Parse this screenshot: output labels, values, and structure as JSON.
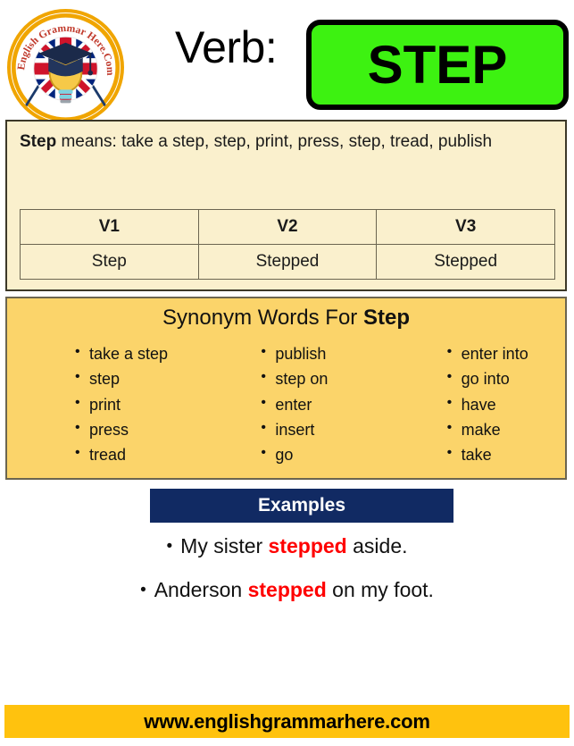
{
  "logo": {
    "brand_text": "English Grammar Here.Com",
    "icon_name": "english-grammar-here-badge"
  },
  "header": {
    "verb_label": "Verb:",
    "verb_word": "STEP",
    "chip_color": "#3DF211"
  },
  "definition": {
    "word": "Step",
    "lead": " means: ",
    "meanings": "take a step, step, print, press, step, tread, publish"
  },
  "verb_table": {
    "headers": [
      "V1",
      "V2",
      "V3"
    ],
    "values": [
      "Step",
      "Stepped",
      "Stepped"
    ]
  },
  "synonyms": {
    "title_prefix": "Synonym Words For ",
    "title_word": "Step",
    "columns": [
      [
        "take a step",
        "step",
        "print",
        "press",
        "tread"
      ],
      [
        "publish",
        "step on",
        "enter",
        "insert",
        "go"
      ],
      [
        "enter into",
        "go into",
        "have",
        "make",
        "take"
      ]
    ]
  },
  "examples": {
    "banner": "Examples",
    "bullet": "•",
    "items": [
      {
        "before": "My sister ",
        "highlight": "stepped",
        "after": " aside."
      },
      {
        "before": "Anderson ",
        "highlight": "stepped",
        "after": " on my foot."
      }
    ],
    "highlight_color": "#FF0000"
  },
  "footer": {
    "url": "www.englishgrammarhere.com",
    "bar_color": "#FFC20E"
  }
}
